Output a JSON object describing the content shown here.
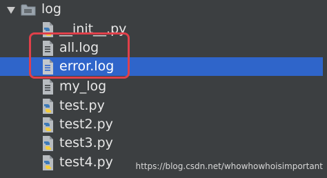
{
  "tree": {
    "folder": {
      "label": "log",
      "expanded": true,
      "icon": "folder-icon"
    },
    "files": [
      {
        "label": "__init__.py",
        "icon": "python-file-icon",
        "selected": false
      },
      {
        "label": "all.log",
        "icon": "text-file-icon",
        "selected": false
      },
      {
        "label": "error.log",
        "icon": "text-file-icon",
        "selected": true
      },
      {
        "label": "my_log",
        "icon": "text-file-icon",
        "selected": false
      },
      {
        "label": "test.py",
        "icon": "python-file-icon",
        "selected": false
      },
      {
        "label": "test2.py",
        "icon": "python-file-icon",
        "selected": false
      },
      {
        "label": "test3.py",
        "icon": "python-file-icon",
        "selected": false
      },
      {
        "label": "test4.py",
        "icon": "python-file-icon",
        "selected": false
      }
    ]
  },
  "annotation": {
    "color": "#e0404a",
    "note": "red rounded rectangle highlighting all.log and error.log"
  },
  "watermark": "https://blog.csdn.net/whowhowhoisimportant",
  "colors": {
    "background": "#3c3f41",
    "selection": "#2f65ca",
    "text": "#e8e8e8",
    "python_blue": "#3d7ab8",
    "python_yellow": "#f5cd3b",
    "text_file_gray": "#b8bcc0"
  }
}
